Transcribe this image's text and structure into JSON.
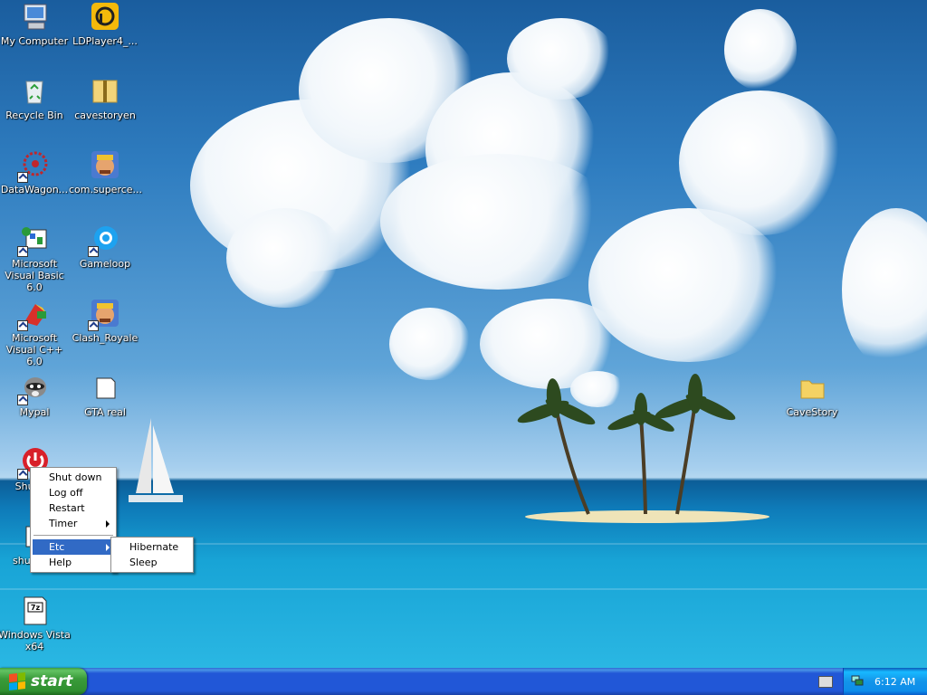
{
  "desktop": {
    "icons": [
      {
        "label": "My Computer",
        "icon": "my-computer-icon"
      },
      {
        "label": "LDPlayer4_...",
        "icon": "ldplayer-icon"
      },
      {
        "label": "Recycle Bin",
        "icon": "recycle-bin-icon"
      },
      {
        "label": "cavestoryen",
        "icon": "zip-folder-icon"
      },
      {
        "label": "DataWagon...",
        "icon": "datawagon-icon"
      },
      {
        "label": "com.superce...",
        "icon": "clash-royale-icon"
      },
      {
        "label": "Microsoft Visual Basic 6.0",
        "icon": "visual-basic-icon"
      },
      {
        "label": "Gameloop",
        "icon": "gameloop-icon"
      },
      {
        "label": "Microsoft Visual C++ 6.0",
        "icon": "visual-cpp-icon"
      },
      {
        "label": "Clash_Royale",
        "icon": "clash-royale-icon"
      },
      {
        "label": "Mypal",
        "icon": "mypal-raccoon-icon"
      },
      {
        "label": "GTA real",
        "icon": "blank-file-icon"
      },
      {
        "label": "Shutd...",
        "icon": "shutdown-power-icon"
      },
      {
        "label": "shutdo...",
        "icon": "shutdown-file-icon"
      },
      {
        "label": "Windows Vista x64",
        "icon": "7z-archive-icon"
      },
      {
        "label": "CaveStory",
        "icon": "folder-icon"
      }
    ]
  },
  "context_menu": {
    "items": [
      "Shut down",
      "Log off",
      "Restart",
      "Timer",
      "Etc",
      "Help"
    ],
    "selected": "Etc"
  },
  "submenu": {
    "items": [
      "Hibernate",
      "Sleep"
    ]
  },
  "taskbar": {
    "start_label": "start",
    "clock": "6:12 AM"
  },
  "colors": {
    "taskbar_blue": "#2157d7",
    "start_green": "#3a9b3a",
    "menu_highlight": "#316ac5"
  }
}
